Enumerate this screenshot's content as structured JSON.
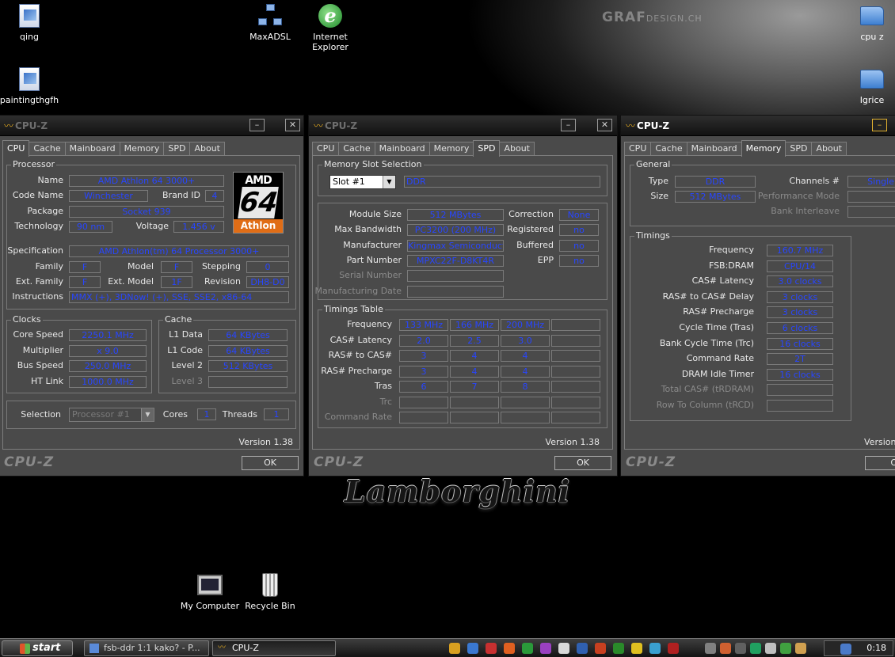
{
  "desktop": {
    "watermark_main": "GRAF",
    "watermark_sub": "DESIGN.CH",
    "wallpaper_text": "Lamborghini",
    "icons": [
      {
        "label": "qing",
        "icon": "document-icon"
      },
      {
        "label": "MaxADSL",
        "icon": "network-icon"
      },
      {
        "label": "Internet Explorer",
        "icon": "internet-explorer-icon"
      },
      {
        "label": "cpu z",
        "icon": "folder-icon"
      },
      {
        "label": "paintingthgfh",
        "icon": "document-icon"
      },
      {
        "label": "Igrice",
        "icon": "folder-icon"
      },
      {
        "label": "My Computer",
        "icon": "computer-icon"
      },
      {
        "label": "Recycle Bin",
        "icon": "recycle-bin-icon"
      }
    ]
  },
  "window_title": "CPU-Z",
  "footer_brand": "CPU-Z",
  "ok_label": "OK",
  "version": "Version 1.38",
  "tabs": [
    "CPU",
    "Cache",
    "Mainboard",
    "Memory",
    "SPD",
    "About"
  ],
  "cpu": {
    "processor_title": "Processor",
    "name_label": "Name",
    "name": "AMD Athlon 64 3000+",
    "codename_label": "Code Name",
    "codename": "Winchester",
    "brandid_label": "Brand ID",
    "brandid": "4",
    "package_label": "Package",
    "package": "Socket 939",
    "technology_label": "Technology",
    "technology": "90 nm",
    "voltage_label": "Voltage",
    "voltage": "1.456 v",
    "spec_label": "Specification",
    "spec": "AMD Athlon(tm) 64 Processor 3000+",
    "family_label": "Family",
    "family": "F",
    "model_label": "Model",
    "model": "F",
    "stepping_label": "Stepping",
    "stepping": "0",
    "extfamily_label": "Ext. Family",
    "extfamily": "F",
    "extmodel_label": "Ext. Model",
    "extmodel": "1F",
    "revision_label": "Revision",
    "revision": "DH8-D0",
    "instructions_label": "Instructions",
    "instructions": "MMX (+), 3DNow! (+), SSE, SSE2, x86-64",
    "logo": {
      "top": "AMD",
      "middle": "64",
      "bottom": "Athlon"
    },
    "clocks_title": "Clocks",
    "corespeed_label": "Core Speed",
    "corespeed": "2250.1 MHz",
    "multiplier_label": "Multiplier",
    "multiplier": "x 9.0",
    "busspeed_label": "Bus Speed",
    "busspeed": "250.0 MHz",
    "htlink_label": "HT Link",
    "htlink": "1000.0 MHz",
    "cache_title": "Cache",
    "l1data_label": "L1 Data",
    "l1data": "64 KBytes",
    "l1code_label": "L1 Code",
    "l1code": "64 KBytes",
    "level2_label": "Level 2",
    "level2": "512 KBytes",
    "level3_label": "Level 3",
    "selection_label": "Selection",
    "selection": "Processor #1",
    "cores_label": "Cores",
    "cores": "1",
    "threads_label": "Threads",
    "threads": "1"
  },
  "spd": {
    "slot_title": "Memory Slot Selection",
    "slot": "Slot #1",
    "type": "DDR",
    "modulesize_label": "Module Size",
    "modulesize": "512 MBytes",
    "correction_label": "Correction",
    "correction": "None",
    "maxbw_label": "Max Bandwidth",
    "maxbw": "PC3200 (200 MHz)",
    "registered_label": "Registered",
    "registered": "no",
    "manufacturer_label": "Manufacturer",
    "manufacturer": "Kingmax Semiconductor",
    "buffered_label": "Buffered",
    "buffered": "no",
    "partnumber_label": "Part Number",
    "partnumber": "MPXC22F-D8KT4R",
    "epp_label": "EPP",
    "epp": "no",
    "serial_label": "Serial Number",
    "mfgdate_label": "Manufacturing Date",
    "timings_title": "Timings Table",
    "timing_rows": [
      {
        "label": "Frequency",
        "v": [
          "133 MHz",
          "166 MHz",
          "200 MHz",
          ""
        ]
      },
      {
        "label": "CAS# Latency",
        "v": [
          "2.0",
          "2.5",
          "3.0",
          ""
        ]
      },
      {
        "label": "RAS# to CAS#",
        "v": [
          "3",
          "4",
          "4",
          ""
        ]
      },
      {
        "label": "RAS# Precharge",
        "v": [
          "3",
          "4",
          "4",
          ""
        ]
      },
      {
        "label": "Tras",
        "v": [
          "6",
          "7",
          "8",
          ""
        ]
      },
      {
        "label": "Trc",
        "v": [
          "",
          "",
          "",
          ""
        ]
      },
      {
        "label": "Command Rate",
        "v": [
          "",
          "",
          "",
          ""
        ]
      }
    ]
  },
  "memory": {
    "general_title": "General",
    "type_label": "Type",
    "type": "DDR",
    "channels_label": "Channels #",
    "channels": "Single",
    "size_label": "Size",
    "size": "512 MBytes",
    "perfmode_label": "Performance Mode",
    "bankinterleave_label": "Bank Interleave",
    "timings_title": "Timings",
    "timing_rows": [
      {
        "label": "Frequency",
        "v": "160.7 MHz"
      },
      {
        "label": "FSB:DRAM",
        "v": "CPU/14"
      },
      {
        "label": "CAS# Latency",
        "v": "3.0 clocks"
      },
      {
        "label": "RAS# to CAS# Delay",
        "v": "3 clocks"
      },
      {
        "label": "RAS# Precharge",
        "v": "3 clocks"
      },
      {
        "label": "Cycle Time (Tras)",
        "v": "6 clocks"
      },
      {
        "label": "Bank Cycle Time (Trc)",
        "v": "16 clocks"
      },
      {
        "label": "Command Rate",
        "v": "2T"
      },
      {
        "label": "DRAM Idle Timer",
        "v": "16 clocks"
      },
      {
        "label": "Total CAS# (tRDRAM)",
        "v": ""
      },
      {
        "label": "Row To Column (tRCD)",
        "v": ""
      }
    ],
    "version_short": "Version",
    "ok_short": "O"
  },
  "taskbar": {
    "start": "start",
    "buttons": [
      "fsb-ddr 1:1 kako? - P...",
      "CPU-Z"
    ],
    "clock": "0:18",
    "tray_colors": [
      "#d9a020",
      "#3a78d0",
      "#c83030",
      "#e06020",
      "#2a9a3a",
      "#9a40c0",
      "#d8d8d8",
      "#3060b0",
      "#c84020",
      "#2a8a2a",
      "#e0c020",
      "#3aa0d0",
      "#b02020",
      "#808080",
      "#d06030",
      "#606060",
      "#20a060",
      "#c0c0c0",
      "#40a040",
      "#d0a050"
    ]
  },
  "colors": {
    "value_text": "#2846ff",
    "window_bg": "#4a4a4a",
    "accent": "#d9a320",
    "amd_orange": "#e06d16"
  }
}
